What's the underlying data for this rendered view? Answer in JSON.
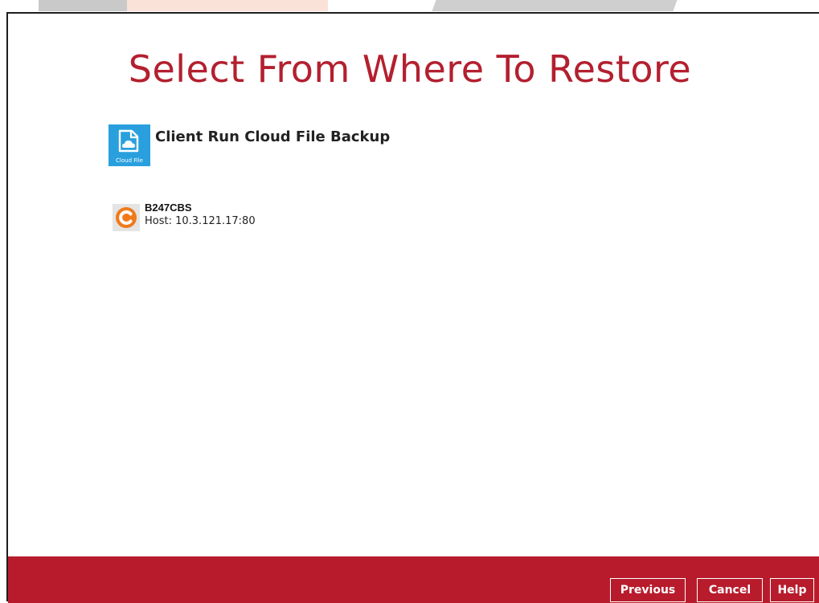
{
  "page": {
    "title": "Select From Where To Restore"
  },
  "module": {
    "icon_label": "Cloud File",
    "name": "Client Run Cloud File Backup"
  },
  "destination": {
    "name": "B247CBS",
    "host": "Host: 10.3.121.17:80",
    "icon_color": "#f07a1a"
  },
  "footer": {
    "previous_label": "Previous",
    "cancel_label": "Cancel",
    "help_label": "Help"
  },
  "colors": {
    "accent": "#b81c2c",
    "title": "#b3202f",
    "module_icon_bg": "#29a0dd"
  }
}
